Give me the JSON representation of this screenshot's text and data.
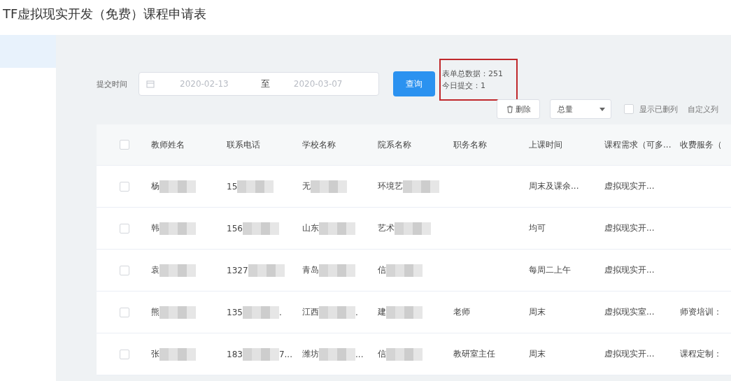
{
  "title": "TF虚拟现实开发（免费）课程申请表",
  "filter": {
    "label": "提交时间",
    "start": "2020-02-13",
    "separator": "至",
    "end": "2020-03-07",
    "query_button": "查询"
  },
  "stats": {
    "total": "表单总数据：251",
    "today": "今日提交：1"
  },
  "toolbar": {
    "delete_button": "删除",
    "select": "总量",
    "show_deleted": {
      "label": "显示已删列",
      "checked": false
    },
    "custom_columns": "自定义列"
  },
  "table": {
    "header_checked": false,
    "columns": [
      "教师姓名",
      "联系电话",
      "学校名称",
      "院系名称",
      "职务名称",
      "上课时间",
      "课程需求（可多...",
      "收费服务（"
    ],
    "rows": [
      {
        "checked": false,
        "cells": [
          {
            "text": "杨",
            "redacted": true
          },
          {
            "text": "15",
            "redacted": true
          },
          {
            "text": "无",
            "redacted": true
          },
          {
            "text": "环境艺",
            "redacted": true
          },
          {},
          {
            "text": "周末及课余..."
          },
          {
            "text": "虚拟现实开..."
          },
          {}
        ]
      },
      {
        "checked": false,
        "cells": [
          {
            "text": "韩",
            "redacted": true
          },
          {
            "text": "156",
            "redacted": true
          },
          {
            "text": "山东",
            "redacted": true
          },
          {
            "text": "艺术",
            "redacted": true
          },
          {},
          {
            "text": "均可"
          },
          {
            "text": "虚拟现实开..."
          },
          {}
        ]
      },
      {
        "checked": false,
        "cells": [
          {
            "text": "袁",
            "redacted": true
          },
          {
            "text": "1327",
            "redacted": true
          },
          {
            "text": "青岛",
            "redacted": true
          },
          {
            "text": "信",
            "redacted": true
          },
          {},
          {
            "text": "每周二上午"
          },
          {
            "text": "虚拟现实开..."
          },
          {}
        ]
      },
      {
        "checked": false,
        "cells": [
          {
            "text": "熊",
            "redacted": true
          },
          {
            "text": "135",
            "redacted": true,
            "tail": "."
          },
          {
            "text": "江西",
            "redacted": true,
            "tail": "."
          },
          {
            "text": "建",
            "redacted": true
          },
          {
            "text": "老师"
          },
          {
            "text": "周末"
          },
          {
            "text": "虚拟现实室..."
          },
          {
            "text": "师资培训："
          }
        ]
      },
      {
        "checked": false,
        "cells": [
          {
            "text": "张",
            "redacted": true
          },
          {
            "text": "183",
            "redacted": true,
            "tail": "7..."
          },
          {
            "text": "潍坊",
            "redacted": true,
            "tail": "..."
          },
          {
            "text": "信",
            "redacted": true
          },
          {
            "text": "教研室主任"
          },
          {
            "text": "周末"
          },
          {
            "text": "虚拟现实开..."
          },
          {
            "text": "课程定制："
          }
        ]
      }
    ]
  }
}
